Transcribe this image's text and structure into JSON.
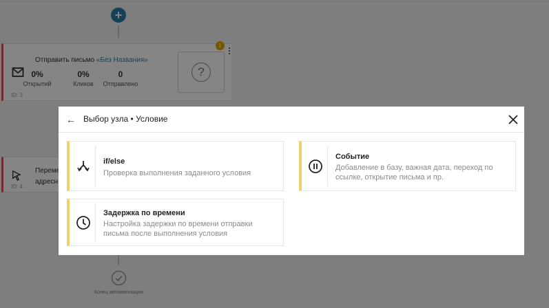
{
  "canvas": {
    "node1": {
      "title_prefix": "Отправить письмо",
      "title_link": "«Без Названия»",
      "stats": [
        {
          "value": "0%",
          "label": "Открытий"
        },
        {
          "value": "0%",
          "label": "Кликов"
        },
        {
          "value": "0",
          "label": "Отправлено"
        }
      ],
      "id_label": "ID: 3",
      "badge": "1"
    },
    "node2": {
      "line1": "Переме",
      "line2": "адресн",
      "id_label": "ID: 4"
    },
    "end_label": "Конец автоматизации"
  },
  "modal": {
    "back_symbol": "←",
    "title": "Выбор узла • Условие",
    "cards": [
      {
        "title": "if/else",
        "description": "Проверка выполнения заданного условия",
        "icon": "branch-icon"
      },
      {
        "title": "Событие",
        "description": "Добавление в базу, важная дата, переход по ссылке, открытие письма и пр.",
        "icon": "pause-circle-icon"
      },
      {
        "title": "Задержка по времени",
        "description": "Настройка задержки по времени отправки письма после выполнения условия",
        "icon": "clock-icon"
      }
    ]
  },
  "colors": {
    "accent_blue": "#2a7fa6",
    "card_border_yellow": "#f2d16b",
    "node_border_red": "#d9534f",
    "badge_orange": "#e5a400"
  }
}
